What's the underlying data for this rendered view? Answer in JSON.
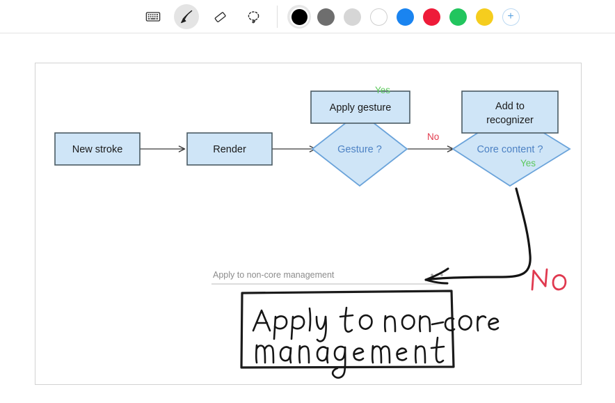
{
  "toolbar": {
    "tools": [
      {
        "name": "keyboard-tool",
        "icon": "keyboard-icon",
        "label": "Keyboard",
        "selected": false
      },
      {
        "name": "pen-tool",
        "icon": "pen-icon",
        "label": "Pen",
        "selected": true
      },
      {
        "name": "eraser-tool",
        "icon": "eraser-icon",
        "label": "Eraser",
        "selected": false
      },
      {
        "name": "lasso-tool",
        "icon": "lasso-select-icon",
        "label": "Lasso select",
        "selected": false
      }
    ],
    "colors": [
      {
        "name": "black",
        "hex": "#000000",
        "selected": true
      },
      {
        "name": "dark-grey",
        "hex": "#6e6e6e",
        "selected": false
      },
      {
        "name": "light-grey",
        "hex": "#d6d6d6",
        "selected": false
      },
      {
        "name": "white",
        "hex": "#ffffff",
        "selected": false
      },
      {
        "name": "blue",
        "hex": "#1a84f0",
        "selected": false
      },
      {
        "name": "red",
        "hex": "#ee1b39",
        "selected": false
      },
      {
        "name": "green",
        "hex": "#22c councils",
        "selected": false
      },
      {
        "name": "yellow",
        "hex": "#f5cd1e",
        "selected": false
      }
    ],
    "add_color_label": "+"
  },
  "diagram": {
    "nodes": [
      {
        "id": "new-stroke",
        "label": "New stroke",
        "shape": "rect",
        "text_color": "#1a1a1a"
      },
      {
        "id": "render",
        "label": "Render",
        "shape": "rect",
        "text_color": "#1a1a1a"
      },
      {
        "id": "gesture",
        "label": "Gesture ?",
        "shape": "diamond",
        "text_color": "#4d82c4"
      },
      {
        "id": "apply-gesture",
        "label": "Apply gesture",
        "shape": "rect",
        "text_color": "#1a1a1a"
      },
      {
        "id": "core-content",
        "label": "Core content ?",
        "shape": "diamond",
        "text_color": "#4d82c4"
      },
      {
        "id": "add-to-recognizer",
        "label_line1": "Add to",
        "label_line2": "recognizer",
        "shape": "rect",
        "text_color": "#1a1a1a"
      }
    ],
    "edge_labels": [
      {
        "id": "gesture-yes",
        "text": "Yes",
        "color": "#5cc85c"
      },
      {
        "id": "gesture-no",
        "text": "No",
        "color": "#e23b4e"
      },
      {
        "id": "core-content-yes",
        "text": "Yes",
        "color": "#5cc85c"
      },
      {
        "id": "core-content-no-handwritten",
        "text": "No",
        "color": "#e0394f"
      }
    ],
    "colors": {
      "node_fill": "#cfe5f7",
      "node_border_dark": "#4a5a63",
      "diamond_border": "#6aa3da",
      "arrow": "#3a3a3a",
      "ink": "#1b1b1b"
    }
  },
  "note": {
    "suggestion_text": "Apply to non-core management",
    "overflow_menu": "•••",
    "handwriting_line1": "Apply to non-core",
    "handwriting_line2": "management"
  }
}
